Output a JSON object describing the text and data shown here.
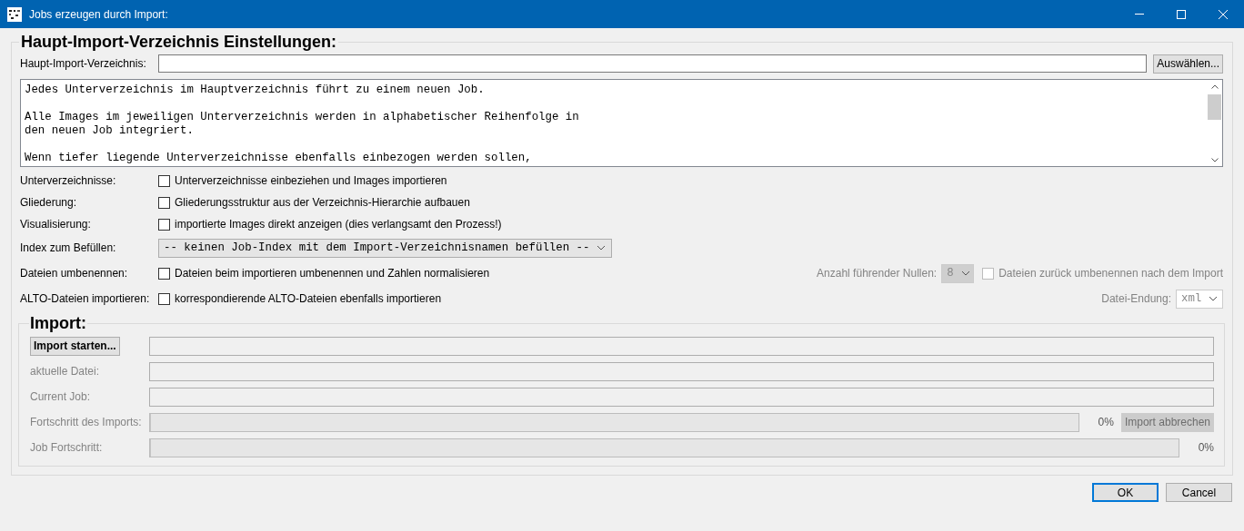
{
  "window": {
    "title": "Jobs erzeugen durch Import:"
  },
  "settings": {
    "legend": "Haupt-Import-Verzeichnis Einstellungen:",
    "directory": {
      "label": "Haupt-Import-Verzeichnis:",
      "button": "Auswählen..."
    },
    "info_paragraphs": [
      "Jedes Unterverzeichnis im Hauptverzeichnis führt zu einem neuen Job.",
      "Alle Images im jeweiligen Unterverzeichnis werden in alphabetischer Reihenfolge in\nden neuen Job integriert.",
      "Wenn tiefer liegende Unterverzeichnisse ebenfalls einbezogen werden sollen,"
    ],
    "options": [
      {
        "kind": "checkbox",
        "label": "Unterverzeichnisse:",
        "text": "Unterverzeichnisse einbeziehen und Images importieren",
        "checked": false
      },
      {
        "kind": "checkbox",
        "label": "Gliederung:",
        "text": "Gliederungsstruktur aus der Verzeichnis-Hierarchie aufbauen",
        "checked": false
      },
      {
        "kind": "checkbox",
        "label": "Visualisierung:",
        "text": "importierte Images direkt anzeigen (dies verlangsamt den Prozess!)",
        "checked": false
      },
      {
        "kind": "select",
        "label": "Index zum Befüllen:",
        "value": "-- keinen Job-Index mit dem Import-Verzeichnisnamen befüllen --"
      },
      {
        "kind": "checkbox",
        "label": "Dateien umbenennen:",
        "text": "Dateien beim importieren umbenennen und Zahlen normalisieren",
        "checked": false,
        "extras": [
          {
            "kind": "select",
            "label": "Anzahl führender Nullen:",
            "value": "8",
            "disabled": true
          },
          {
            "kind": "checkbox",
            "text": "Dateien zurück umbenennen nach dem Import",
            "checked": false,
            "disabled": true
          }
        ]
      },
      {
        "kind": "checkbox",
        "label": "ALTO-Dateien importieren:",
        "text": "korrespondierende ALTO-Dateien ebenfalls importieren",
        "checked": false,
        "extras": [
          {
            "kind": "select",
            "label": "Datei-Endung:",
            "value": "xml",
            "disabled": true
          }
        ]
      }
    ]
  },
  "import": {
    "legend": "Import:",
    "rows": [
      {
        "kind": "button",
        "label": "Import starten...",
        "disabled": false
      },
      {
        "kind": "field",
        "label": "aktuelle Datei:",
        "disabled": true
      },
      {
        "kind": "field",
        "label": "Current Job:",
        "disabled": true
      },
      {
        "kind": "progress",
        "label": "Fortschritt des Imports:",
        "level": 0,
        "reading": "0%",
        "button": {
          "label": "Import abbrechen",
          "disabled": true
        }
      },
      {
        "kind": "progress",
        "label": "Job Fortschritt:",
        "level": 0,
        "reading": "0%"
      }
    ]
  },
  "buttons": [
    {
      "label": "OK",
      "default": true
    },
    {
      "label": "Cancel",
      "default": false
    }
  ]
}
